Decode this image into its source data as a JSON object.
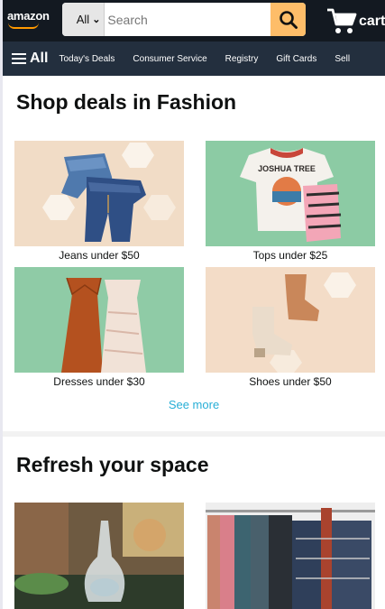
{
  "header": {
    "logo_text": "amazon",
    "search": {
      "category": "All",
      "placeholder": "Search"
    },
    "cart_label": "cart",
    "accent_color": "#febd69",
    "bg_color": "#131921"
  },
  "nav": {
    "all_label": "All",
    "links": [
      "Today's Deals",
      "Consumer Service",
      "Registry",
      "Gift Cards",
      "Sell"
    ],
    "bg_color": "#232f3e"
  },
  "fashion": {
    "title": "Shop deals in Fashion",
    "items": [
      {
        "label": "Jeans under $50",
        "icon": "jeans-image"
      },
      {
        "label": "Tops under $25",
        "icon": "tops-image"
      },
      {
        "label": "Dresses under $30",
        "icon": "dresses-image"
      },
      {
        "label": "Shoes under $50",
        "icon": "shoes-image"
      }
    ],
    "see_more": "See more"
  },
  "refresh": {
    "title": "Refresh your space",
    "items": [
      {
        "label": "",
        "icon": "dining-image"
      },
      {
        "label": "",
        "icon": "closet-image"
      }
    ]
  }
}
